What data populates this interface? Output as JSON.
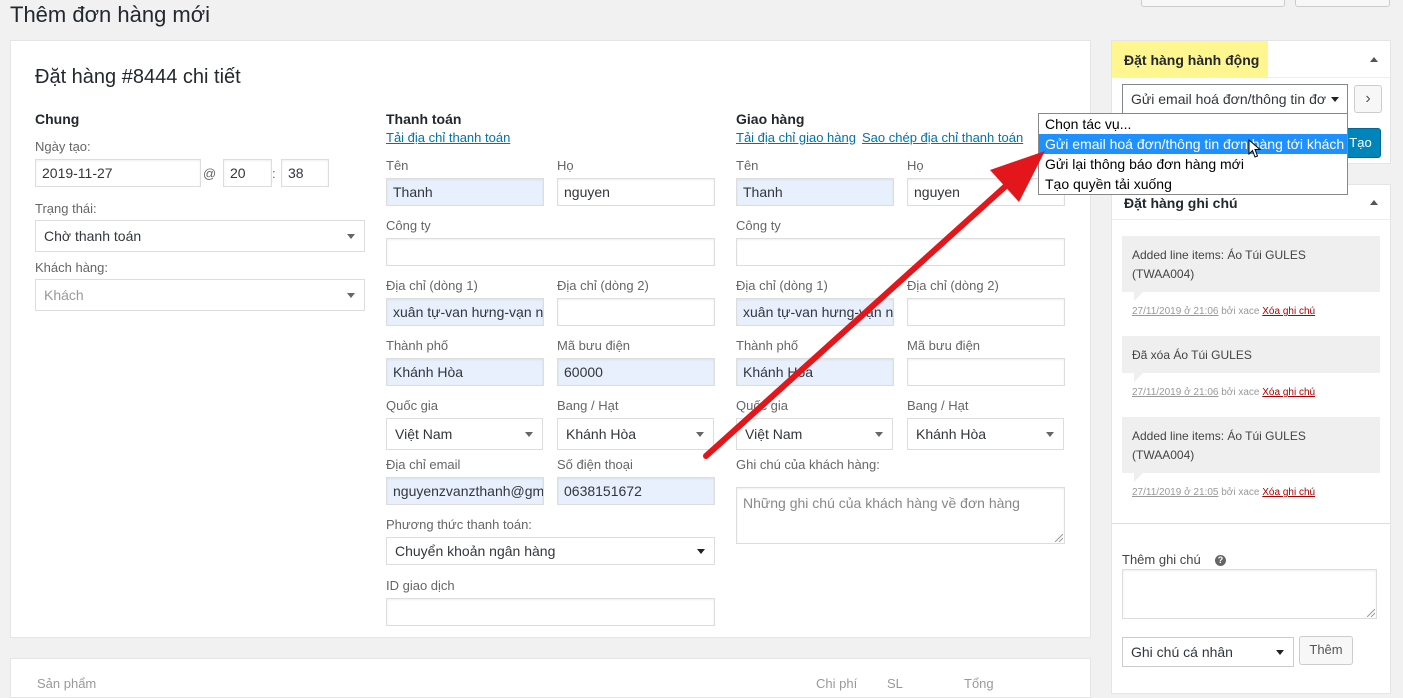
{
  "page": {
    "title": "Thêm đơn hàng mới"
  },
  "order": {
    "heading": "Đặt hàng #8444 chi tiết",
    "general": {
      "title": "Chung",
      "date_label": "Ngày tạo:",
      "date": "2019-11-27",
      "at": "@",
      "hour": "20",
      "colon": ":",
      "minute": "38",
      "status_label": "Trạng thái:",
      "status": "Chờ thanh toán",
      "customer_label": "Khách hàng:",
      "customer_placeholder": "Khách"
    },
    "billing": {
      "title": "Thanh toán",
      "load_link": "Tải địa chỉ thanh toán",
      "first_name_label": "Tên",
      "first_name": "Thanh",
      "last_name_label": "Họ",
      "last_name": "nguyen",
      "company_label": "Công ty",
      "company": "",
      "address1_label": "Địa chỉ (dòng 1)",
      "address1": "xuân tự-van hưng-vạn n",
      "address2_label": "Địa chỉ (dòng 2)",
      "address2": "",
      "city_label": "Thành phố",
      "city": "Khánh Hòa",
      "postcode_label": "Mã bưu điện",
      "postcode": "60000",
      "country_label": "Quốc gia",
      "country": "Việt Nam",
      "state_label": "Bang / Hạt",
      "state": "Khánh Hòa",
      "email_label": "Địa chỉ email",
      "email": "nguyenzvanzthanh@gm",
      "phone_label": "Số điện thoại",
      "phone": "0638151672",
      "payment_label": "Phương thức thanh toán:",
      "payment": "Chuyển khoản ngân hàng",
      "txn_label": "ID giao dịch",
      "txn": ""
    },
    "shipping": {
      "title": "Giao hàng",
      "load_link": "Tải địa chỉ giao hàng",
      "copy_link": "Sao chép địa chỉ thanh toán",
      "first_name_label": "Tên",
      "first_name": "Thanh",
      "last_name_label": "Họ",
      "last_name": "nguyen",
      "company_label": "Công ty",
      "company": "",
      "address1_label": "Địa chỉ (dòng 1)",
      "address1": "xuân tự-van hưng-vạn n",
      "address2_label": "Địa chỉ (dòng 2)",
      "address2": "",
      "city_label": "Thành phố",
      "city": "Khánh Hòa",
      "postcode_label": "Mã bưu điện",
      "postcode": "",
      "country_label": "Quốc gia",
      "country": "Việt Nam",
      "state_label": "Bang / Hạt",
      "state": "Khánh Hòa",
      "note_label": "Ghi chú của khách hàng:",
      "note_placeholder": "Những ghi chú của khách hàng về đơn hàng"
    }
  },
  "items_header": {
    "product": "Sản phẩm",
    "cost": "Chi phí",
    "qty": "SL",
    "total": "Tổng"
  },
  "actions": {
    "title": "Đặt hàng hành động",
    "selected": "Gửi email hoá đơn/thông tin đơ",
    "go_label": "›",
    "create_label": "Tạo",
    "options": [
      "Chọn tác vụ...",
      "Gửi email hoá đơn/thông tin đơn hàng tới khách",
      "Gửi lại thông báo đơn hàng mới",
      "Tạo quyền tải xuống"
    ]
  },
  "notes": {
    "title": "Đặt hàng ghi chú",
    "by": "bởi xace",
    "delete_label": "Xóa ghi chú",
    "items": [
      {
        "text": "Added line items: Áo Túi GULES (TWAA004)",
        "date": "27/11/2019 ở 21:06"
      },
      {
        "text": "Đã xóa Áo Túi GULES",
        "date": "27/11/2019 ở 21:06"
      },
      {
        "text": "Added line items: Áo Túi GULES (TWAA004)",
        "date": "27/11/2019 ở 21:05"
      }
    ],
    "add_label": "Thêm ghi chú",
    "help_icon": "?",
    "type_selected": "Ghi chú cá nhân",
    "add_button": "Thêm"
  },
  "colors": {
    "highlight": "#fff68f",
    "primary": "#0085ba",
    "arrow": "#e3161b",
    "option_highlight": "#1e90ff"
  }
}
